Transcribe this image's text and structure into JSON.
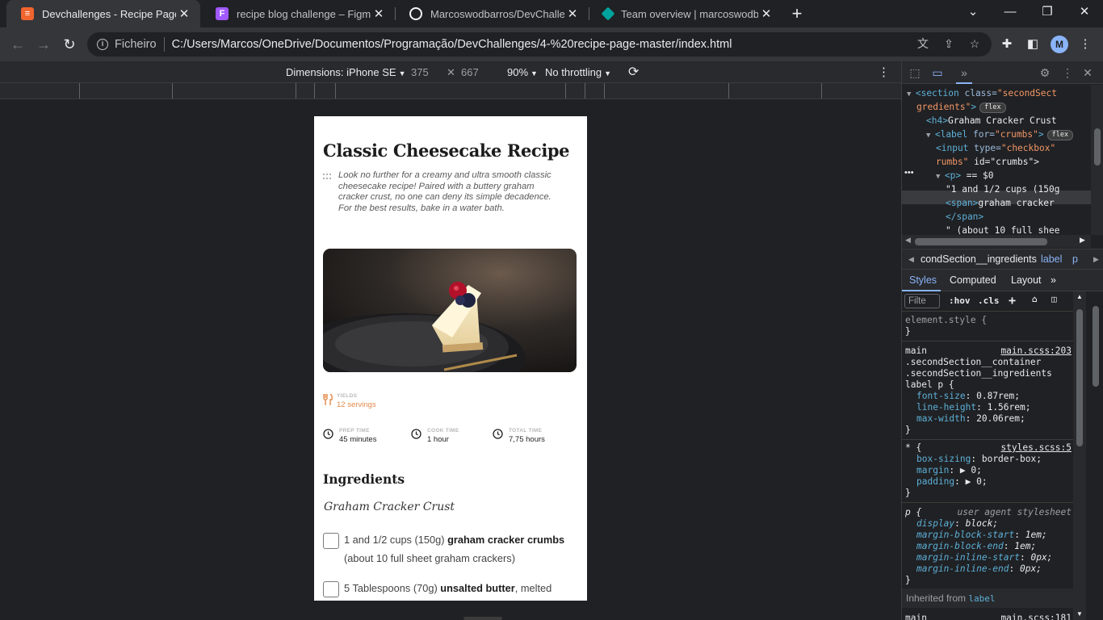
{
  "browser": {
    "tabs": [
      {
        "title": "Devchallenges - Recipe Page",
        "favicon_color": "#f0642d",
        "favicon_glyph": "≡"
      },
      {
        "title": "recipe blog challenge – Figma",
        "favicon_color": "#a259ff",
        "favicon_glyph": "F"
      },
      {
        "title": "Marcoswodbarros/DevChallenge",
        "favicon_color": "#f5f5f5",
        "favicon_glyph": "●"
      },
      {
        "title": "Team overview | marcoswodbarro",
        "favicon_color": "#00a39e",
        "favicon_glyph": "◆"
      }
    ],
    "address": {
      "scheme": "Ficheiro",
      "url": "C:/Users/Marcos/OneDrive/Documentos/Programação/DevChallenges/4-%20recipe-page-master/index.html"
    },
    "profile_initial": "M"
  },
  "device_toolbar": {
    "dimensions_label": "Dimensions: iPhone SE",
    "width": "375",
    "height": "667",
    "zoom": "90%",
    "throttling": "No throttling"
  },
  "recipe": {
    "title": "Classic Cheesecake Recipe",
    "description": "Look no further for a creamy and ultra smooth classic cheesecake recipe! Paired with a buttery graham cracker crust, no one can deny its simple decadence. For the best results, bake in a water bath.",
    "yields": {
      "label": "YIELDS",
      "value": "12 servings"
    },
    "times": [
      {
        "label": "PREP TIME",
        "value": "45 minutes"
      },
      {
        "label": "COOK TIME",
        "value": "1 hour"
      },
      {
        "label": "TOTAL TIME",
        "value": "7,75 hours"
      }
    ],
    "ingredients_heading": "Ingredients",
    "section_heading": "Graham Cracker Crust",
    "ingredients": [
      {
        "pre": "1 and 1/2 cups (150g) ",
        "bold": "graham cracker crumbs",
        "post": " (about 10 full sheet graham crackers)"
      },
      {
        "pre": "5 Tablespoons (70g) ",
        "bold": "unsalted butter",
        "post": ", melted"
      }
    ],
    "accent_color": "#e38a4a"
  },
  "devtools": {
    "dom": [
      {
        "indent": 4,
        "tri": "▼",
        "open": "<section",
        "attr": " class=",
        "val": "\"secondSect",
        "extra": ""
      },
      {
        "indent": 5,
        "tri": "",
        "open": "",
        "attr": "",
        "val": "gredients\"",
        "extra": ">",
        "badge": "flex"
      },
      {
        "indent": 6,
        "tri": "",
        "open": "<h4>",
        "attr": "",
        "val": "",
        "extra": "Graham Cracker Crust"
      },
      {
        "indent": 6,
        "tri": "▼",
        "open": "<label",
        "attr": " for=",
        "val": "\"crumbs\"",
        "extra": ">",
        "badge": "flex"
      },
      {
        "indent": 7,
        "tri": "",
        "open": "<input",
        "attr": " type=",
        "val": "\"checkbox\"",
        "extra": ""
      },
      {
        "indent": 7,
        "tri": "",
        "open": "",
        "attr": "",
        "val": "rumbs\"",
        "extra": " id=\"crumbs\">"
      },
      {
        "indent": 7,
        "tri": "▼",
        "open": "<p>",
        "attr": "",
        "val": "",
        "extra": " == $0"
      },
      {
        "indent": 8,
        "tri": "",
        "open": "",
        "attr": "",
        "val": "",
        "extra": "\"1 and 1/2 cups (150g"
      },
      {
        "indent": 8,
        "tri": "",
        "open": "<span>",
        "attr": "",
        "val": "",
        "extra": "graham cracker"
      },
      {
        "indent": 8,
        "tri": "",
        "open": "</span>",
        "attr": "",
        "val": "",
        "extra": ""
      },
      {
        "indent": 8,
        "tri": "",
        "open": "",
        "attr": "",
        "val": "",
        "extra": "\" (about 10 full shee"
      }
    ],
    "breadcrumbs": [
      "condSection__ingredients",
      "label",
      "p"
    ],
    "panel_tabs": [
      "Styles",
      "Computed",
      "Layout"
    ],
    "filter_placeholder": "Filte",
    "hov": ":hov",
    "cls": ".cls",
    "rules": [
      {
        "selector": "element.style {",
        "source": "",
        "props": [],
        "close": "}"
      },
      {
        "selector": "main",
        "source": "main.scss:203",
        "selector_more": [
          ".secondSection__container",
          ".secondSection__ingredients",
          "label p {"
        ],
        "props": [
          {
            "n": "font-size",
            "v": "0.87rem;"
          },
          {
            "n": "line-height",
            "v": "1.56rem;"
          },
          {
            "n": "max-width",
            "v": "20.06rem;"
          }
        ],
        "close": "}"
      },
      {
        "selector": "* {",
        "source": "styles.scss:5",
        "props": [
          {
            "n": "box-sizing",
            "v": "border-box;"
          },
          {
            "n": "margin",
            "v": "▶ 0;"
          },
          {
            "n": "padding",
            "v": "▶ 0;"
          }
        ],
        "close": "}"
      },
      {
        "selector": "p {",
        "source": "user agent stylesheet",
        "props": [
          {
            "n": "display",
            "v": "block;"
          },
          {
            "n": "margin-block-start",
            "v": "1em;"
          },
          {
            "n": "margin-block-end",
            "v": "1em;"
          },
          {
            "n": "margin-inline-start",
            "v": "0px;"
          },
          {
            "n": "margin-inline-end",
            "v": "0px;"
          }
        ],
        "close": "}"
      }
    ],
    "inherited_label": "Inherited from",
    "inherited_tag": "label",
    "next_rule": {
      "selector": "main",
      "source": "main.scss:181"
    }
  }
}
